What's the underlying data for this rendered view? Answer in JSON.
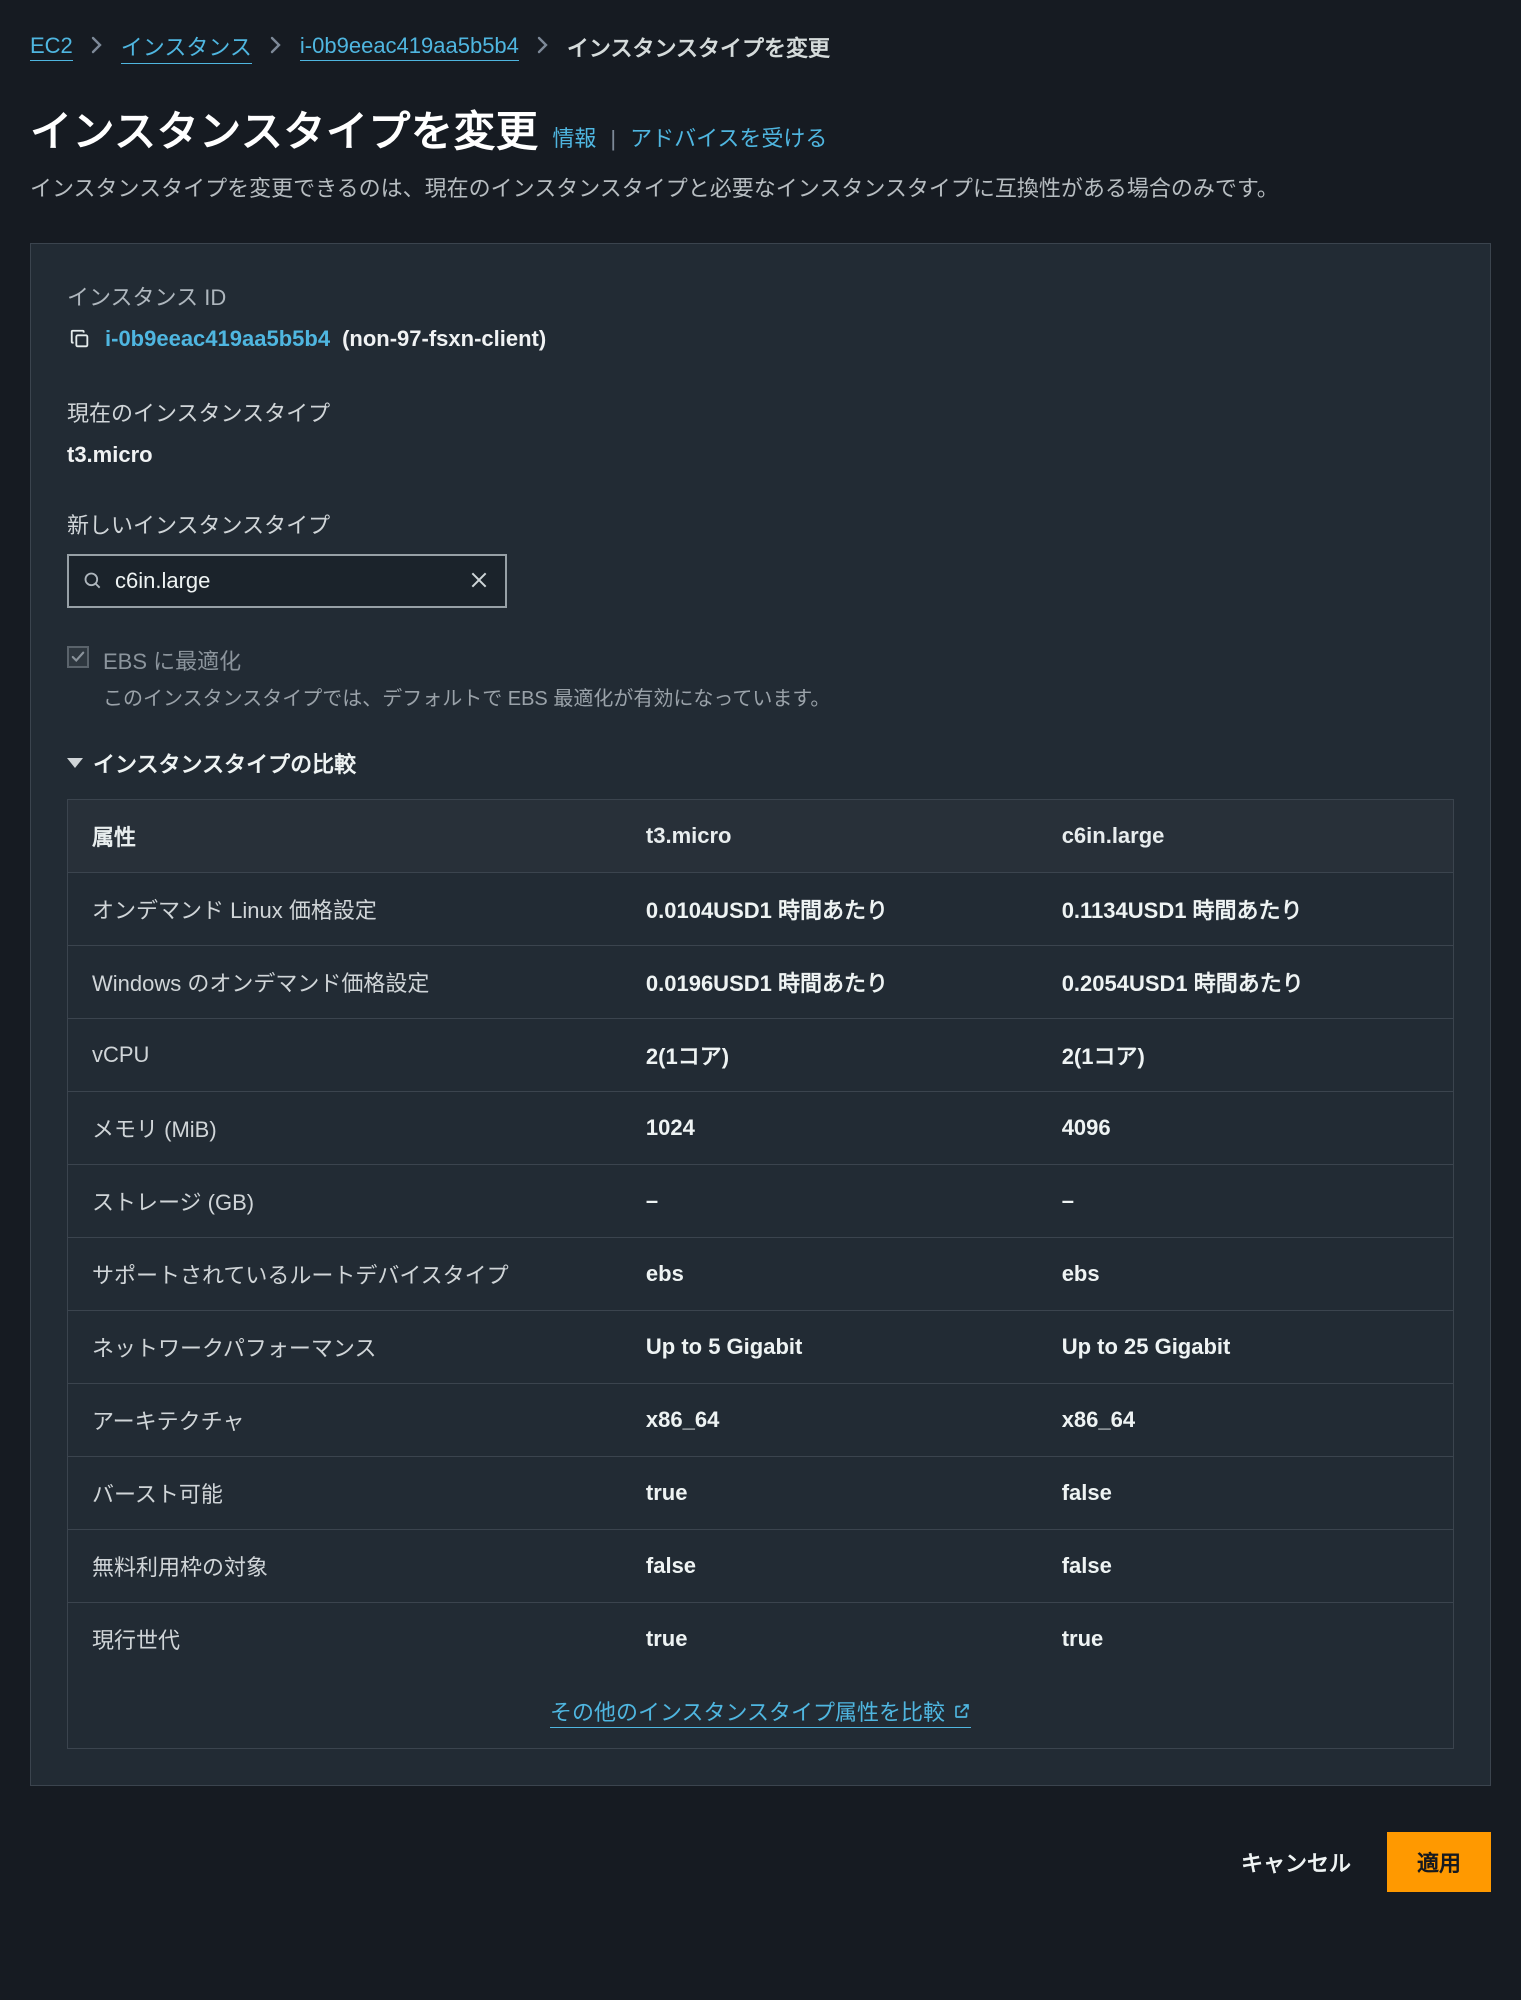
{
  "breadcrumb": {
    "ec2": "EC2",
    "instances": "インスタンス",
    "instance_id": "i-0b9eeac419aa5b5b4",
    "current": "インスタンスタイプを変更"
  },
  "title": "インスタンスタイプを変更",
  "title_links": {
    "info": "情報",
    "advice": "アドバイスを受ける"
  },
  "subtitle": "インスタンスタイプを変更できるのは、現在のインスタンスタイプと必要なインスタンスタイプに互換性がある場合のみです。",
  "panel": {
    "instance_id_label": "インスタンス ID",
    "instance_id": "i-0b9eeac419aa5b5b4",
    "instance_name": "(non-97-fsxn-client)",
    "current_type_label": "現在のインスタンスタイプ",
    "current_type_value": "t3.micro",
    "new_type_label": "新しいインスタンスタイプ",
    "new_type_value": "c6in.large",
    "ebs_optimize_label": "EBS に最適化",
    "ebs_optimize_sub": "このインスタンスタイプでは、デフォルトで EBS 最適化が有効になっています。",
    "compare_header": "インスタンスタイプの比較",
    "compare_more": "その他のインスタンスタイプ属性を比較",
    "table": {
      "headers": {
        "attr": "属性",
        "col1": "t3.micro",
        "col2": "c6in.large"
      },
      "rows": [
        {
          "attr": "オンデマンド Linux 価格設定",
          "col1": "0.0104USD1 時間あたり",
          "col2": "0.1134USD1 時間あたり"
        },
        {
          "attr": "Windows のオンデマンド価格設定",
          "col1": "0.0196USD1 時間あたり",
          "col2": "0.2054USD1 時間あたり"
        },
        {
          "attr": "vCPU",
          "col1": "2(1コア)",
          "col2": "2(1コア)"
        },
        {
          "attr": "メモリ (MiB)",
          "col1": "1024",
          "col2": "4096"
        },
        {
          "attr": "ストレージ (GB)",
          "col1": "–",
          "col2": "–"
        },
        {
          "attr": "サポートされているルートデバイスタイプ",
          "col1": "ebs",
          "col2": "ebs"
        },
        {
          "attr": "ネットワークパフォーマンス",
          "col1": "Up to 5 Gigabit",
          "col2": "Up to 25 Gigabit"
        },
        {
          "attr": "アーキテクチャ",
          "col1": "x86_64",
          "col2": "x86_64"
        },
        {
          "attr": "バースト可能",
          "col1": "true",
          "col2": "false"
        },
        {
          "attr": "無料利用枠の対象",
          "col1": "false",
          "col2": "false"
        },
        {
          "attr": "現行世代",
          "col1": "true",
          "col2": "true"
        }
      ]
    }
  },
  "footer": {
    "cancel": "キャンセル",
    "apply": "適用"
  }
}
